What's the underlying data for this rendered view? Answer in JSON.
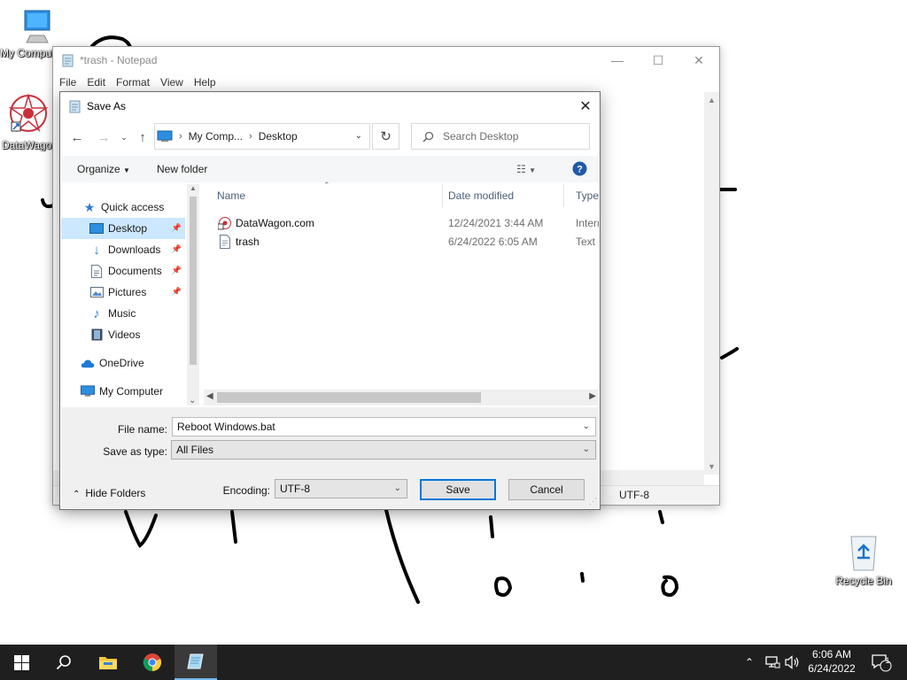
{
  "desktop": {
    "icons": [
      {
        "label": "My Computer",
        "icon": "monitor-icon"
      },
      {
        "label": "DataWagon",
        "icon": "datawagon-logo-icon"
      },
      {
        "label": "Recycle Bin",
        "icon": "recycle-bin-icon"
      }
    ]
  },
  "notepad": {
    "title": "*trash - Notepad",
    "menu": [
      "File",
      "Edit",
      "Format",
      "View",
      "Help"
    ],
    "status_encoding": "UTF-8"
  },
  "dialog": {
    "title": "Save As",
    "breadcrumb": [
      "My Comp...",
      "Desktop"
    ],
    "search_placeholder": "Search Desktop",
    "toolbar": {
      "organize": "Organize",
      "new_folder": "New folder"
    },
    "nav_items": [
      {
        "label": "Quick access",
        "icon": "star-icon"
      },
      {
        "label": "Desktop",
        "icon": "desktop-folder-icon",
        "selected": true
      },
      {
        "label": "Downloads",
        "icon": "download-arrow-icon"
      },
      {
        "label": "Documents",
        "icon": "documents-icon"
      },
      {
        "label": "Pictures",
        "icon": "pictures-icon"
      },
      {
        "label": "Music",
        "icon": "music-note-icon"
      },
      {
        "label": "Videos",
        "icon": "film-icon"
      },
      {
        "label": "OneDrive",
        "icon": "cloud-icon"
      },
      {
        "label": "My Computer",
        "icon": "monitor-icon"
      }
    ],
    "columns": [
      "Name",
      "Date modified",
      "Type"
    ],
    "files": [
      {
        "name": "DataWagon.com",
        "date": "12/24/2021 3:44 AM",
        "type": "Internet Shortcut",
        "icon": "url-shortcut-icon"
      },
      {
        "name": "trash",
        "date": "6/24/2022 6:05 AM",
        "type": "Text Document",
        "icon": "text-file-icon"
      }
    ],
    "file_name_label": "File name:",
    "file_name_value": "Reboot Windows.bat",
    "save_type_label": "Save as type:",
    "save_type_value": "All Files",
    "hide_folders": "Hide Folders",
    "encoding_label": "Encoding:",
    "encoding_value": "UTF-8",
    "save_button": "Save",
    "cancel_button": "Cancel"
  },
  "taskbar": {
    "apps": [
      "start-icon",
      "search-icon",
      "file-explorer-icon",
      "chrome-icon",
      "notepad-icon"
    ],
    "time": "6:06 AM",
    "date": "6/24/2022",
    "notification_count": "1"
  },
  "colors": {
    "accent": "#0078d7",
    "selection": "#cce8ff",
    "taskbar": "#1f1f1f"
  }
}
